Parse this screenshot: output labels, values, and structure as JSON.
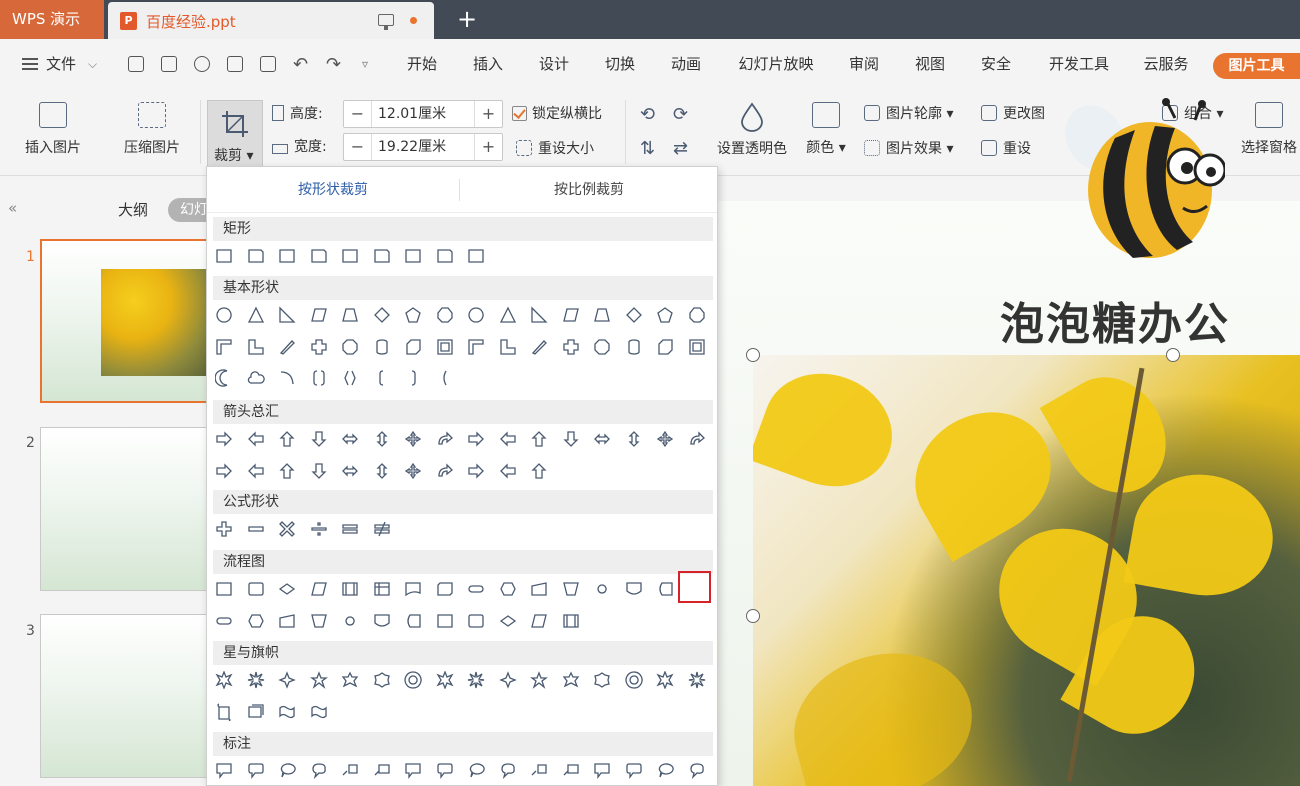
{
  "titlebar": {
    "app_name": "WPS 演示",
    "doc_name": "百度经验.ppt",
    "doc_icon": "P",
    "new_tab": "+"
  },
  "menubar": {
    "file_label": "文件",
    "tabs": [
      "开始",
      "插入",
      "设计",
      "切换",
      "动画",
      "幻灯片放映",
      "审阅",
      "视图",
      "安全",
      "开发工具",
      "云服务"
    ],
    "active_tab": "图片工具",
    "accent_color": "#e8742f"
  },
  "ribbon": {
    "insert_picture": "插入图片",
    "compress_picture": "压缩图片",
    "crop": "裁剪",
    "height_label": "高度:",
    "height_value": "12.01厘米",
    "width_label": "宽度:",
    "width_value": "19.22厘米",
    "lock_ratio": "锁定纵横比",
    "lock_ratio_checked": true,
    "reset_size": "重设大小",
    "set_transparent": "设置透明色",
    "color": "颜色",
    "picture_outline": "图片轮廓",
    "picture_effect": "图片效果",
    "change_picture": "更改图",
    "reset": "重设",
    "combine": "组合",
    "select_pane": "选择窗格"
  },
  "leftpanel": {
    "collapse": "«",
    "outline_tab": "大纲",
    "slides_tab": "幻灯",
    "slides": [
      "1",
      "2",
      "3"
    ]
  },
  "slide": {
    "brand_text": "泡泡糖办公"
  },
  "crop_menu": {
    "tab_shape": "按形状裁剪",
    "tab_ratio": "按比例裁剪",
    "categories": [
      "矩形",
      "基本形状",
      "箭头总汇",
      "公式形状",
      "流程图",
      "星与旗帜",
      "标注"
    ]
  }
}
